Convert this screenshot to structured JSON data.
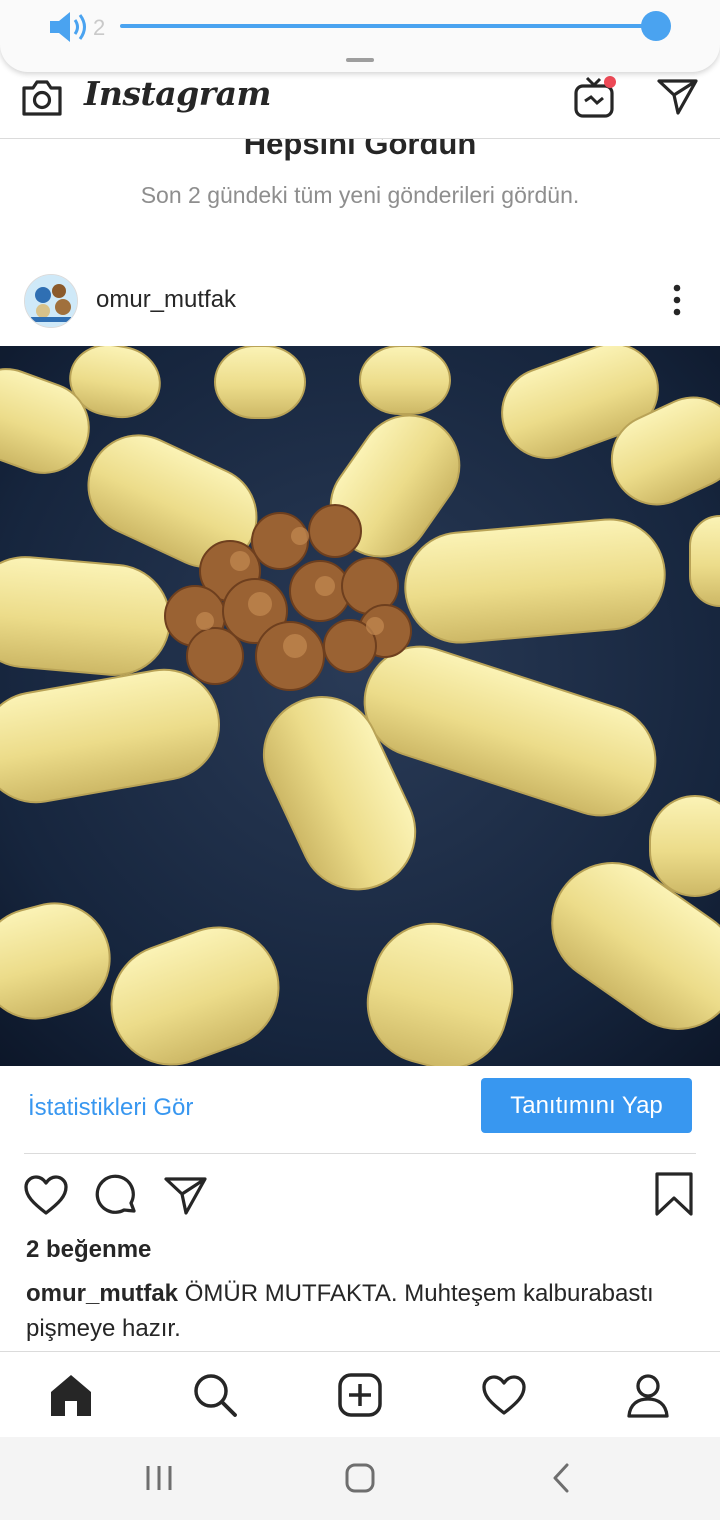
{
  "volume": {
    "level": "2",
    "icon": "speaker-icon",
    "accent": "#4aa3f0"
  },
  "header": {
    "logo": "Instagram",
    "camera_icon": "camera-icon",
    "igtv_icon": "igtv-icon",
    "direct_icon": "direct-message-icon",
    "notification_dot": "#ed4956"
  },
  "caught_up": {
    "title": "Hepsini Gördün",
    "subtitle": "Son 2 gündeki tüm yeni gönderileri gördün."
  },
  "post": {
    "username": "omur_mutfak",
    "insights_label": "İstatistikleri Gör",
    "promote_label": "Tanıtımını Yap",
    "likes": "2 beğenme",
    "caption_user": "omur_mutfak",
    "caption_text": " ÖMÜR MUTFAKTA. Muhteşem kalburabastı pişmeye hazır."
  },
  "bottom_nav": {
    "items": [
      "home-icon",
      "search-icon",
      "new-post-icon",
      "activity-icon",
      "profile-icon"
    ]
  },
  "system_nav": {
    "items": [
      "recent-apps-icon",
      "home-button-icon",
      "back-icon"
    ]
  },
  "colors": {
    "link": "#3897f0",
    "text": "#262626",
    "muted": "#8e8e8e",
    "divider": "#dbdbdb"
  }
}
